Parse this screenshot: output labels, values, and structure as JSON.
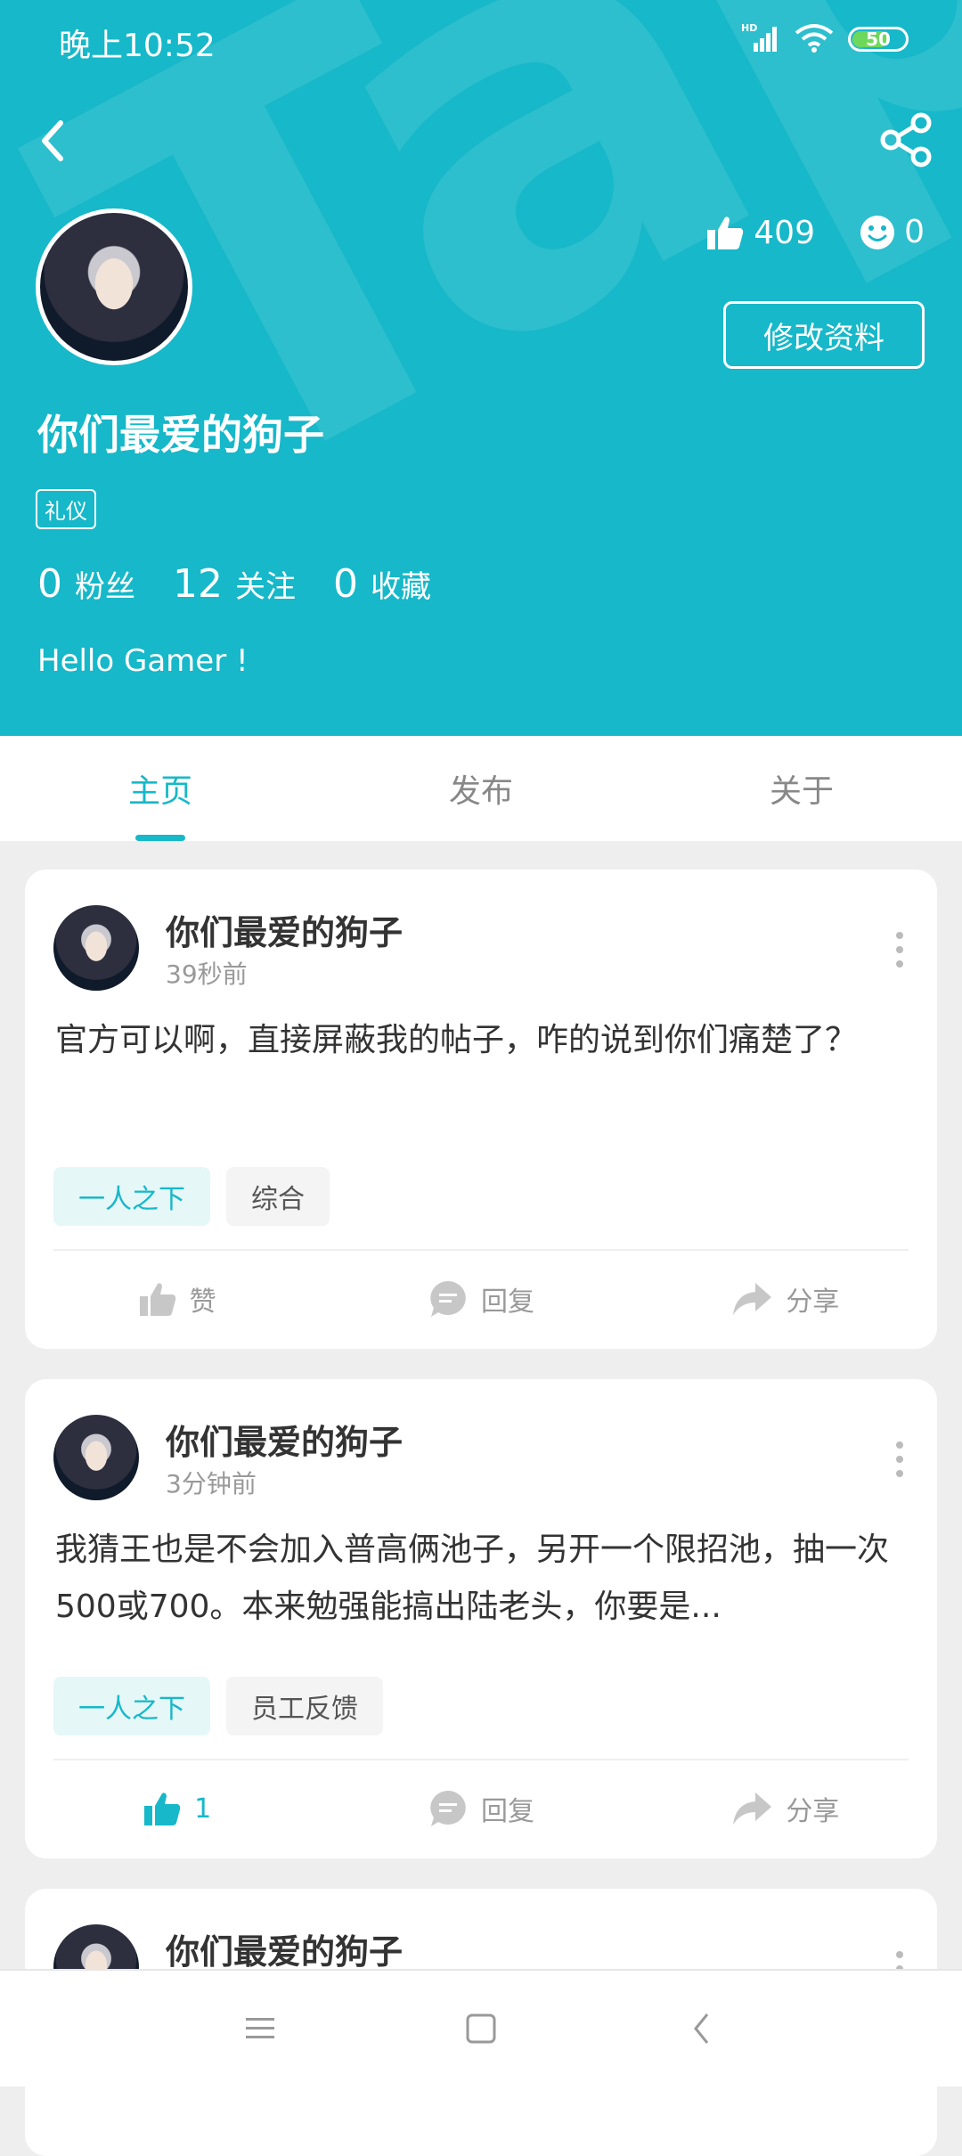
{
  "status_bar": {
    "time": "晚上10:52",
    "network": "HD",
    "battery": "50"
  },
  "header": {
    "likes": "409",
    "smiles": "0",
    "edit_label": "修改资料",
    "username": "你们最爱的狗子",
    "badge": "礼仪",
    "stats": [
      {
        "num": "0",
        "label": "粉丝"
      },
      {
        "num": "12",
        "label": "关注"
      },
      {
        "num": "0",
        "label": "收藏"
      }
    ],
    "bio": "Hello Gamer !"
  },
  "tabs": [
    {
      "label": "主页"
    },
    {
      "label": "发布"
    },
    {
      "label": "关于"
    }
  ],
  "posts": [
    {
      "author": "你们最爱的狗子",
      "time": "39秒前",
      "text": "官方可以啊，直接屏蔽我的帖子，咋的说到你们痛楚了？",
      "tags": [
        "一人之下",
        "综合"
      ],
      "like_label": "赞",
      "reply_label": "回复",
      "share_label": "分享"
    },
    {
      "author": "你们最爱的狗子",
      "time": "3分钟前",
      "text": "我猜王也是不会加入普高俩池子，另开一个限招池，抽一次500或700。本来勉强能搞出陆老头，你要是...",
      "tags": [
        "一人之下",
        "员工反馈"
      ],
      "like_label": "1",
      "reply_label": "回复",
      "share_label": "分享"
    },
    {
      "author": "你们最爱的狗子"
    }
  ],
  "colors": {
    "accent": "#16b8c9"
  }
}
